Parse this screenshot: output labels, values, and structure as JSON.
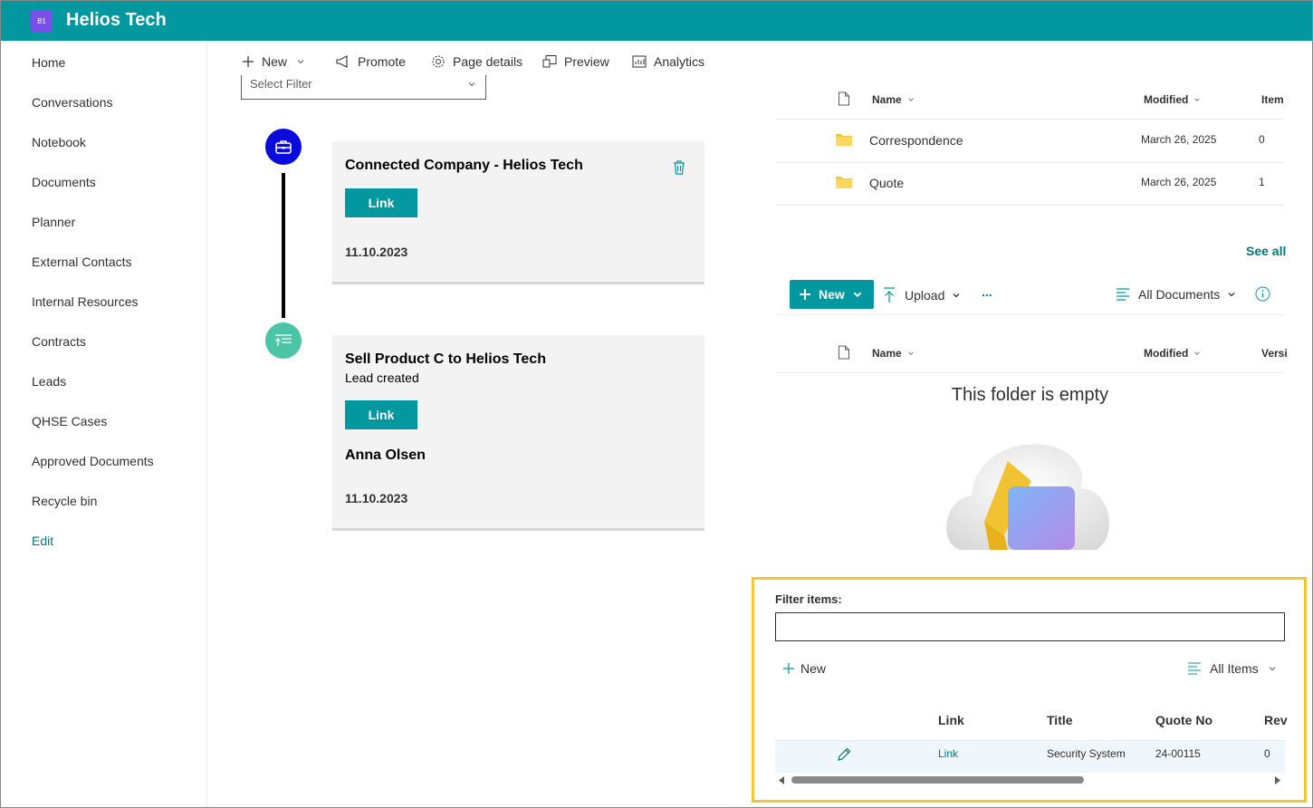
{
  "header": {
    "site_badge": "B1",
    "site_title": "Helios Tech",
    "brand_color": "#03979f"
  },
  "nav": {
    "items": [
      "Home",
      "Conversations",
      "Notebook",
      "Documents",
      "Planner",
      "External Contacts",
      "Internal Resources",
      "Contracts",
      "Leads",
      "QHSE Cases",
      "Approved Documents",
      "Recycle bin"
    ],
    "edit": "Edit"
  },
  "commandbar": {
    "new": "New",
    "promote": "Promote",
    "page_details": "Page details",
    "preview": "Preview",
    "analytics": "Analytics"
  },
  "timeline": {
    "filter_placeholder": "Select Filter",
    "cards": [
      {
        "title": "Connected Company - Helios Tech",
        "button": "Link",
        "date": "11.10.2023",
        "icon": "briefcase-icon",
        "dot_color": "#0a0adb"
      },
      {
        "title": "Sell Product C to Helios Tech",
        "subtitle": "Lead created",
        "button": "Link",
        "person": "Anna Olsen",
        "date": "11.10.2023",
        "icon": "lead-upload-icon",
        "dot_color": "#4bc5a5"
      }
    ]
  },
  "folders": {
    "columns": {
      "name": "Name",
      "modified": "Modified",
      "items": "Item"
    },
    "rows": [
      {
        "name": "Correspondence",
        "modified": "March 26, 2025",
        "items": "0"
      },
      {
        "name": "Quote",
        "modified": "March 26, 2025",
        "items": "1"
      }
    ],
    "see_all": "See all"
  },
  "doclib": {
    "new": "New",
    "upload": "Upload",
    "more": "...",
    "view": "All Documents",
    "columns": {
      "name": "Name",
      "modified": "Modified",
      "version": "Versi"
    },
    "empty_text": "This folder is empty"
  },
  "filter_list": {
    "label": "Filter items:",
    "filter_value": "",
    "new": "New",
    "view": "All Items",
    "columns": [
      "Link",
      "Title",
      "Quote No",
      "Rev"
    ],
    "rows": [
      {
        "link": "Link",
        "title": "Security System",
        "quote_no": "24-00115",
        "rev": "0"
      }
    ]
  }
}
